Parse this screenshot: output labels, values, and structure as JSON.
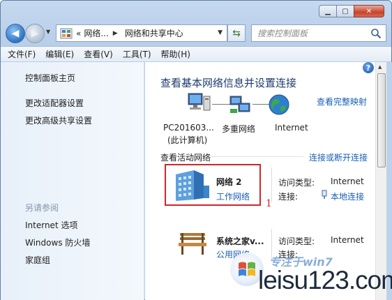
{
  "window": {
    "minimize_label": "▁",
    "maximize_label": "▢",
    "close_label": "✕"
  },
  "address_bar": {
    "prefix": "«",
    "crumb_1": "网络...",
    "separator": "▶",
    "crumb_2": "网络和共享中心"
  },
  "search": {
    "placeholder": "搜索控制面板"
  },
  "menu": [
    "文件(F)",
    "编辑(E)",
    "查看(V)",
    "工具(T)",
    "帮助(H)"
  ],
  "sidebar": {
    "home": "控制面板主页",
    "links": [
      "更改适配器设置",
      "更改高级共享设置"
    ],
    "see_also_heading": "另请参阅",
    "see_also": [
      "Internet 选项",
      "Windows 防火墙",
      "家庭组"
    ]
  },
  "main": {
    "help_label": "?",
    "title": "查看基本网络信息并设置连接",
    "view_full_map": "查看完整映射",
    "map": {
      "pc_name": "PC201603...",
      "pc_sub": "(此计算机)",
      "network": "多重网络",
      "internet": "Internet"
    },
    "active_heading": "查看活动网络",
    "connect_disconnect": "连接或断开连接",
    "networks": [
      {
        "name": "网络  2",
        "type_link": "工作网络",
        "access_label": "访问类型:",
        "access_value": "Internet",
        "conn_label": "连接:",
        "conn_value": "本地连接"
      },
      {
        "name": "系统之家v...",
        "type_link": "公用网络",
        "access_label": "访问类型:",
        "access_value": "Internet",
        "conn_label": "连接:",
        "conn_value": ""
      }
    ]
  },
  "annotation": "1",
  "watermark": {
    "text": "leisu123.com",
    "small": "专注于win7"
  },
  "colors": {
    "link": "#1a5fb4",
    "highlight_box": "#d0262a",
    "title": "#1e3a6e"
  }
}
